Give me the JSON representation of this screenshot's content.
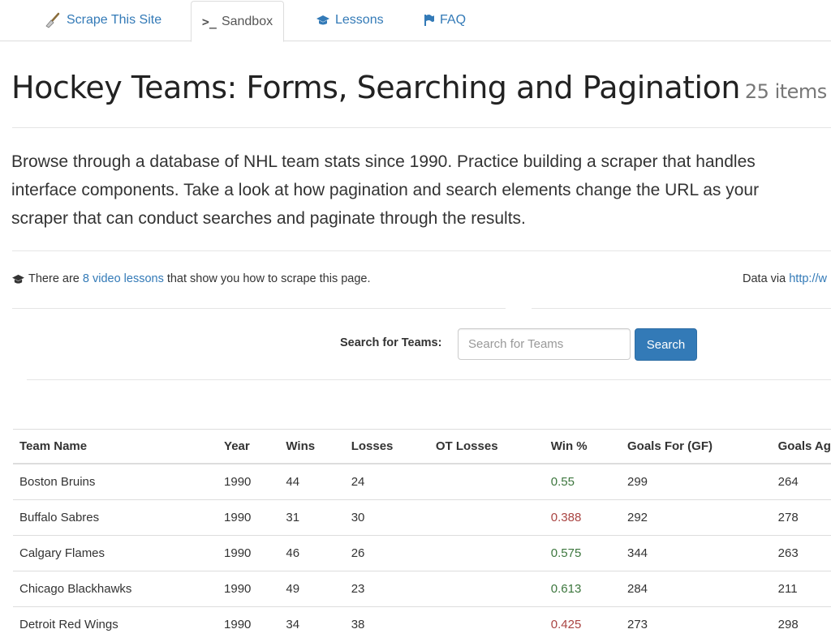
{
  "nav": {
    "brand": "Scrape This Site",
    "tabs": [
      {
        "label": "Sandbox",
        "icon": "terminal-icon",
        "active": true
      },
      {
        "label": "Lessons",
        "icon": "graduation-cap-icon",
        "active": false
      },
      {
        "label": "FAQ",
        "icon": "flag-icon",
        "active": false
      }
    ]
  },
  "page": {
    "title": "Hockey Teams: Forms, Searching and Pagination",
    "count": "25 items",
    "lead": [
      "Browse through a database of NHL team stats since 1990. Practice building a scraper that handles",
      "interface components. Take a look at how pagination and search elements change the URL as your",
      "scraper that can conduct searches and paginate through the results."
    ]
  },
  "info": {
    "prefix": "There are",
    "link": "8 video lessons",
    "suffix": "that show you how to scrape this page.",
    "data_via": "Data via",
    "data_link": "http://w"
  },
  "search": {
    "label": "Search for Teams:",
    "placeholder": "Search for Teams",
    "value": "",
    "button": "Search"
  },
  "table": {
    "headers": [
      "Team Name",
      "Year",
      "Wins",
      "Losses",
      "OT Losses",
      "Win %",
      "Goals For (GF)",
      "Goals Ag"
    ],
    "rows": [
      {
        "name": "Boston Bruins",
        "year": "1990",
        "wins": "44",
        "losses": "24",
        "ot": "",
        "pct": "0.55",
        "pct_status": "good",
        "gf": "299",
        "ga": "264"
      },
      {
        "name": "Buffalo Sabres",
        "year": "1990",
        "wins": "31",
        "losses": "30",
        "ot": "",
        "pct": "0.388",
        "pct_status": "bad",
        "gf": "292",
        "ga": "278"
      },
      {
        "name": "Calgary Flames",
        "year": "1990",
        "wins": "46",
        "losses": "26",
        "ot": "",
        "pct": "0.575",
        "pct_status": "good",
        "gf": "344",
        "ga": "263"
      },
      {
        "name": "Chicago Blackhawks",
        "year": "1990",
        "wins": "49",
        "losses": "23",
        "ot": "",
        "pct": "0.613",
        "pct_status": "good",
        "gf": "284",
        "ga": "211"
      },
      {
        "name": "Detroit Red Wings",
        "year": "1990",
        "wins": "34",
        "losses": "38",
        "ot": "",
        "pct": "0.425",
        "pct_status": "bad",
        "gf": "273",
        "ga": "298"
      }
    ]
  },
  "colors": {
    "link": "#337ab7",
    "good": "#3c763d",
    "bad": "#a94442",
    "button": "#337ab7"
  }
}
